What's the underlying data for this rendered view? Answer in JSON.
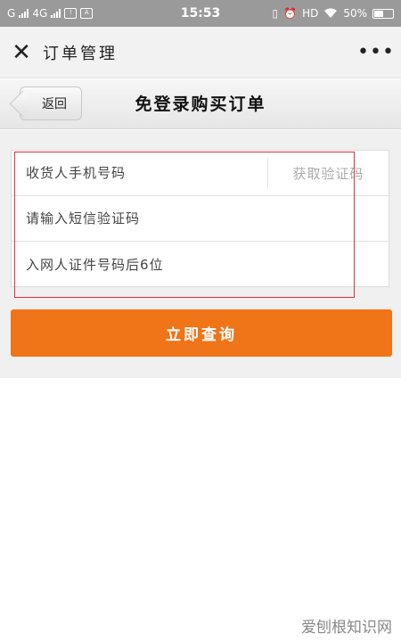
{
  "status_bar": {
    "left_text_1": "G",
    "left_text_2": "4G",
    "sms_glyph": "!",
    "notif_text": "A",
    "time": "15:53",
    "hd": "HD",
    "battery_pct": "50%",
    "battery_level": 0.5
  },
  "title_bar": {
    "close_icon": "close-icon",
    "title": "订单管理",
    "more_icon": "more-icon",
    "more_glyph": "•••",
    "close_glyph": "✕"
  },
  "sub_header": {
    "back_label": "返回",
    "heading": "免登录购买订单"
  },
  "form": {
    "phone_placeholder": "收货人手机号码",
    "get_code_label": "获取验证码",
    "sms_placeholder": "请输入短信验证码",
    "id_placeholder": "入网人证件号码后6位"
  },
  "submit_label": "立即查询",
  "watermark": "爱刨根知识网",
  "colors": {
    "accent": "#f07418",
    "highlight": "#e0303a"
  }
}
